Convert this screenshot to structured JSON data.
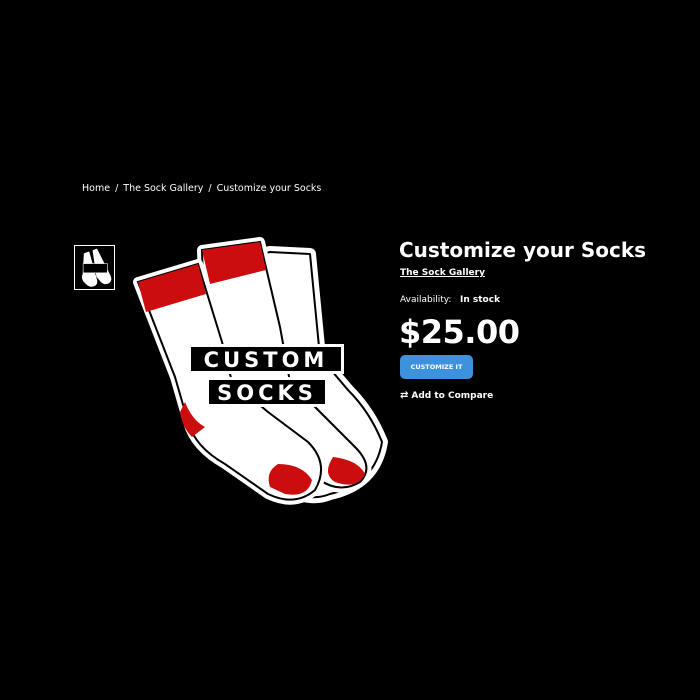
{
  "breadcrumb": {
    "items": [
      "Home",
      "The Sock Gallery",
      "Customize your Socks"
    ],
    "separator": "/"
  },
  "product": {
    "title": "Customize your Socks",
    "brand": "The Sock Gallery",
    "availability_label": "Availability:",
    "availability_value": "In stock",
    "price": "$25.00",
    "customize_button": "CUSTOMIZE IT",
    "compare_label": "Add to Compare",
    "compare_icon": "swap-arrows-icon"
  },
  "image": {
    "logo_line1": "CUSTOM",
    "logo_line2": "SOCKS",
    "sock_stripe_color": "#cc0d0d",
    "sock_body_color": "#ffffff"
  },
  "colors": {
    "background": "#000000",
    "accent": "#3c92dc"
  }
}
